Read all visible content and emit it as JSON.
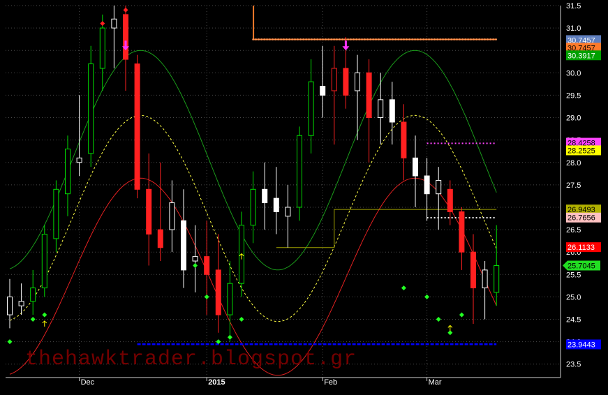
{
  "chart_data": {
    "type": "candlestick",
    "x_labels": [
      "Dec",
      "2015",
      "Feb",
      "Mar"
    ],
    "x_label_bars": [
      6,
      17,
      27,
      36
    ],
    "ylim": [
      23.2,
      31.5
    ],
    "y_ticks": [
      23.5,
      24.0,
      24.5,
      25.0,
      25.5,
      26.0,
      26.5,
      27.0,
      27.5,
      28.0,
      28.5,
      29.0,
      29.5,
      30.0,
      30.5,
      31.0,
      31.5
    ],
    "y_tick_labels": [
      "23.5",
      "24.0",
      "24.5",
      "25.0",
      "25.5",
      "26.0",
      "26.5",
      "27.0",
      "27.5",
      "28.0",
      "28.5",
      "29.0",
      "29.5",
      "30.0",
      "30.5",
      "31.0",
      "31.5"
    ],
    "candles": [
      {
        "o": 24.6,
        "h": 25.4,
        "l": 24.3,
        "c": 25.0,
        "col": "white"
      },
      {
        "o": 24.8,
        "h": 25.3,
        "l": 24.6,
        "c": 24.9,
        "col": "white"
      },
      {
        "o": 24.9,
        "h": 25.6,
        "l": 24.6,
        "c": 25.2,
        "col": "green"
      },
      {
        "o": 25.2,
        "h": 26.6,
        "l": 25.0,
        "c": 26.4,
        "col": "green"
      },
      {
        "o": 26.3,
        "h": 27.6,
        "l": 26.0,
        "c": 27.4,
        "col": "green"
      },
      {
        "o": 27.3,
        "h": 28.6,
        "l": 26.8,
        "c": 28.3,
        "col": "green"
      },
      {
        "o": 28.0,
        "h": 29.5,
        "l": 27.7,
        "c": 28.1,
        "col": "white"
      },
      {
        "o": 28.2,
        "h": 30.6,
        "l": 27.9,
        "c": 30.2,
        "col": "green"
      },
      {
        "o": 30.1,
        "h": 31.3,
        "l": 29.6,
        "c": 31.0,
        "col": "green"
      },
      {
        "o": 31.0,
        "h": 31.5,
        "l": 30.1,
        "c": 31.2,
        "col": "white"
      },
      {
        "o": 31.3,
        "h": 31.5,
        "l": 29.6,
        "c": 30.3,
        "col": "red"
      },
      {
        "o": 30.2,
        "h": 30.4,
        "l": 27.2,
        "c": 27.4,
        "col": "red"
      },
      {
        "o": 27.4,
        "h": 28.2,
        "l": 25.7,
        "c": 26.4,
        "col": "red"
      },
      {
        "o": 26.5,
        "h": 28.0,
        "l": 25.8,
        "c": 26.1,
        "col": "red"
      },
      {
        "o": 26.5,
        "h": 27.6,
        "l": 26.0,
        "c": 27.1,
        "col": "white"
      },
      {
        "o": 26.7,
        "h": 27.4,
        "l": 25.2,
        "c": 25.6,
        "col": "white"
      },
      {
        "o": 25.8,
        "h": 26.6,
        "l": 25.1,
        "c": 25.9,
        "col": "white"
      },
      {
        "o": 25.9,
        "h": 26.7,
        "l": 24.6,
        "c": 25.5,
        "col": "red"
      },
      {
        "o": 25.6,
        "h": 26.4,
        "l": 24.2,
        "c": 24.6,
        "col": "red"
      },
      {
        "o": 24.6,
        "h": 25.8,
        "l": 24.0,
        "c": 25.3,
        "col": "green"
      },
      {
        "o": 25.3,
        "h": 26.9,
        "l": 25.0,
        "c": 26.6,
        "col": "green"
      },
      {
        "o": 26.6,
        "h": 27.8,
        "l": 26.2,
        "c": 27.4,
        "col": "green"
      },
      {
        "o": 27.4,
        "h": 28.0,
        "l": 26.5,
        "c": 27.1,
        "col": "white"
      },
      {
        "o": 27.2,
        "h": 27.9,
        "l": 26.4,
        "c": 26.9,
        "col": "white"
      },
      {
        "o": 26.8,
        "h": 27.5,
        "l": 26.1,
        "c": 27.0,
        "col": "white"
      },
      {
        "o": 27.0,
        "h": 28.8,
        "l": 26.7,
        "c": 28.6,
        "col": "green"
      },
      {
        "o": 28.6,
        "h": 30.3,
        "l": 28.2,
        "c": 29.8,
        "col": "green"
      },
      {
        "o": 29.7,
        "h": 30.6,
        "l": 29.0,
        "c": 29.5,
        "col": "white"
      },
      {
        "o": 29.6,
        "h": 30.6,
        "l": 28.4,
        "c": 30.1,
        "col": "red"
      },
      {
        "o": 30.1,
        "h": 30.8,
        "l": 29.2,
        "c": 29.5,
        "col": "red"
      },
      {
        "o": 29.6,
        "h": 30.4,
        "l": 28.5,
        "c": 30.0,
        "col": "white"
      },
      {
        "o": 30.0,
        "h": 30.3,
        "l": 28.0,
        "c": 29.0,
        "col": "red"
      },
      {
        "o": 29.0,
        "h": 30.0,
        "l": 28.4,
        "c": 29.4,
        "col": "white"
      },
      {
        "o": 29.4,
        "h": 29.8,
        "l": 28.4,
        "c": 28.9,
        "col": "white"
      },
      {
        "o": 28.9,
        "h": 29.3,
        "l": 27.6,
        "c": 28.1,
        "col": "red"
      },
      {
        "o": 28.1,
        "h": 28.6,
        "l": 27.0,
        "c": 27.7,
        "col": "white"
      },
      {
        "o": 27.7,
        "h": 28.1,
        "l": 26.7,
        "c": 27.3,
        "col": "white"
      },
      {
        "o": 27.3,
        "h": 27.9,
        "l": 26.5,
        "c": 27.6,
        "col": "white"
      },
      {
        "o": 27.4,
        "h": 27.6,
        "l": 26.6,
        "c": 26.9,
        "col": "red"
      },
      {
        "o": 26.9,
        "h": 27.0,
        "l": 25.6,
        "c": 26.0,
        "col": "red"
      },
      {
        "o": 26.0,
        "h": 26.4,
        "l": 24.4,
        "c": 25.2,
        "col": "red"
      },
      {
        "o": 25.2,
        "h": 25.8,
        "l": 24.5,
        "c": 25.6,
        "col": "white"
      },
      {
        "o": 25.1,
        "h": 26.6,
        "l": 24.8,
        "c": 25.7,
        "col": "green"
      }
    ],
    "markers_green_diamond": [
      [
        0,
        24.0
      ],
      [
        2,
        24.5
      ],
      [
        3,
        24.6
      ],
      [
        16,
        25.7
      ],
      [
        17,
        25.0
      ],
      [
        18,
        24.0
      ],
      [
        19,
        24.1
      ],
      [
        20,
        24.5
      ],
      [
        34,
        25.2
      ],
      [
        36,
        25.0
      ],
      [
        37,
        24.5
      ],
      [
        38,
        24.2
      ],
      [
        39,
        24.6
      ]
    ],
    "markers_red_dot": [
      [
        8,
        31.1
      ],
      [
        10,
        31.4
      ]
    ],
    "markers_magenta_arrow": [
      [
        10,
        30.5
      ],
      [
        29,
        30.5
      ]
    ],
    "markers_yellow_up": [
      [
        3,
        24.4
      ],
      [
        20,
        25.9
      ],
      [
        38,
        24.3
      ]
    ],
    "horizontal_levels": {
      "orange_top": 30.7457,
      "magenta_dotted": 28.4258,
      "white_dotted": 26.7656,
      "olive_step": 26.9493,
      "blue_bottom": 23.9443
    },
    "price_tags": [
      {
        "value": "30.7457",
        "bg": "#5f7fbf",
        "fg": "#ffffff"
      },
      {
        "value": "30.7457",
        "bg": "#ff7a2a",
        "fg": "#000000"
      },
      {
        "value": "30.3917",
        "bg": "#00a000",
        "fg": "#ffffff"
      },
      {
        "value": "28.4258",
        "bg": "#ff44ff",
        "fg": "#000000"
      },
      {
        "value": "28.2525",
        "bg": "#ffff00",
        "fg": "#000000"
      },
      {
        "value": "26.9493",
        "bg": "#b0b000",
        "fg": "#000000"
      },
      {
        "value": "26.7656",
        "bg": "#ffc0c0",
        "fg": "#000000"
      },
      {
        "value": "26.1133",
        "bg": "#ff0000",
        "fg": "#ffffff"
      },
      {
        "value": "25.7045",
        "bg": "#22dd22",
        "fg": "#000000"
      },
      {
        "value": "23.9443",
        "bg": "#0000ff",
        "fg": "#ffffff"
      }
    ],
    "price_tag_levels": [
      30.73,
      30.56,
      30.39,
      28.44,
      28.27,
      26.95,
      26.77,
      26.11,
      25.7,
      23.94
    ],
    "watermark": "thehawktrader.blogspot.gr",
    "colors": {
      "green": "#00dd00",
      "red": "#ff2020",
      "white": "#ffffff",
      "grid": "#4a4a4a"
    }
  }
}
